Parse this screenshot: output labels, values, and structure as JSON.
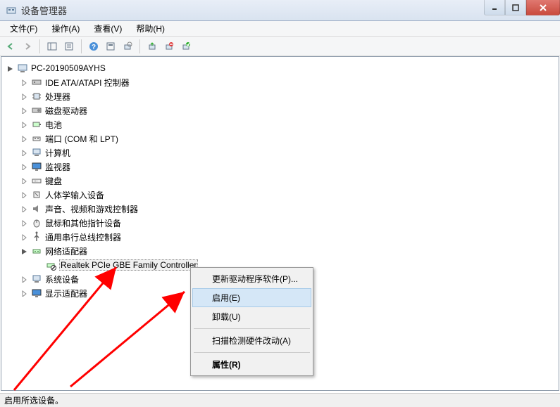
{
  "window": {
    "title": "设备管理器"
  },
  "menu": {
    "file": "文件(F)",
    "action": "操作(A)",
    "view": "查看(V)",
    "help": "帮助(H)"
  },
  "tree": {
    "root": "PC-20190509AYHS",
    "items": [
      "IDE ATA/ATAPI 控制器",
      "处理器",
      "磁盘驱动器",
      "电池",
      "端口 (COM 和 LPT)",
      "计算机",
      "监视器",
      "键盘",
      "人体学输入设备",
      "声音、视频和游戏控制器",
      "鼠标和其他指针设备",
      "通用串行总线控制器",
      "网络适配器",
      "系统设备",
      "显示适配器"
    ],
    "network_child": "Realtek PCIe GBE Family Controller"
  },
  "context_menu": {
    "update_driver": "更新驱动程序软件(P)...",
    "enable": "启用(E)",
    "uninstall": "卸载(U)",
    "scan_hardware": "扫描检测硬件改动(A)",
    "properties": "属性(R)"
  },
  "status": "启用所选设备。"
}
